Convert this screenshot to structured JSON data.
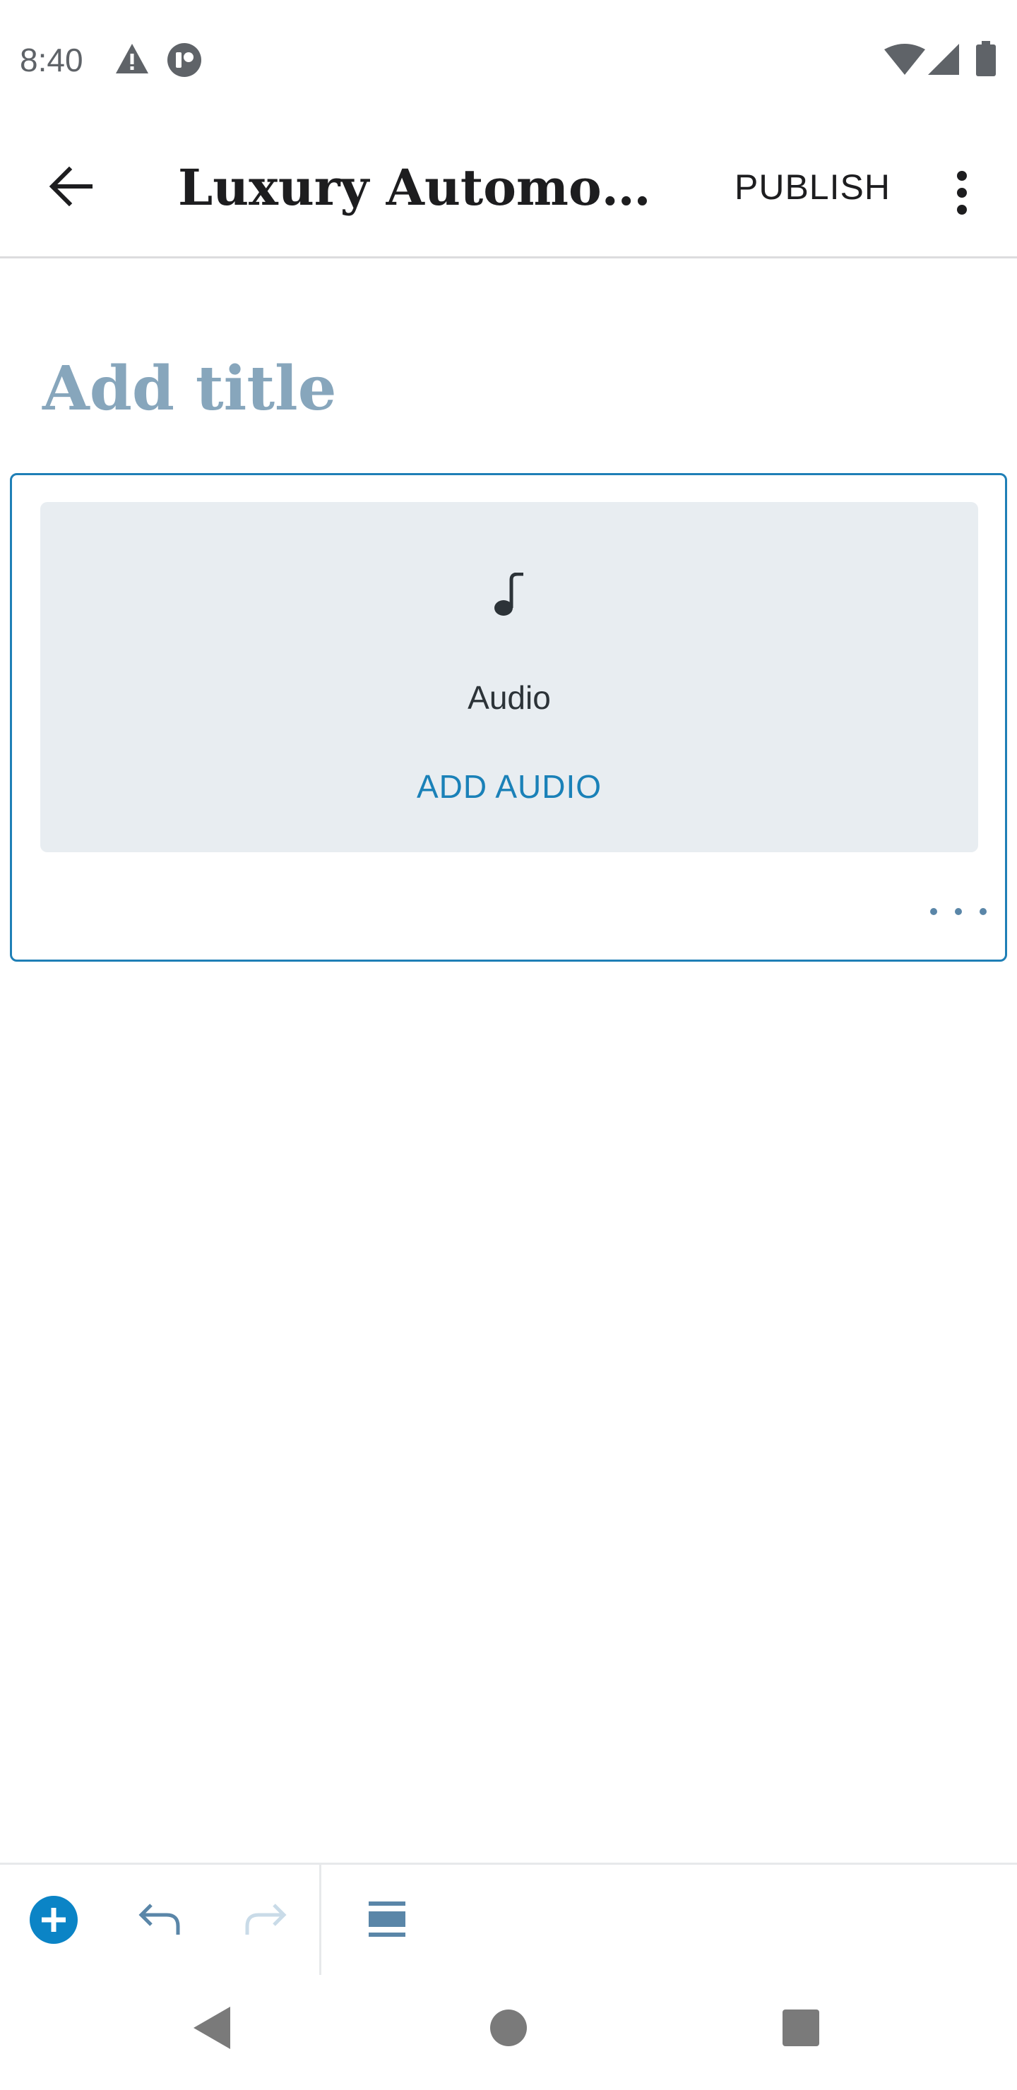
{
  "status_bar": {
    "time": "8:40",
    "icons": [
      "warning-icon",
      "app-notification-icon",
      "wifi-icon",
      "signal-icon",
      "battery-icon"
    ]
  },
  "app_bar": {
    "title": "Luxury Automoti...",
    "publish_label": "PUBLISH",
    "icons": [
      "back-arrow-icon",
      "more-vertical-icon"
    ]
  },
  "editor": {
    "title_placeholder": "Add title",
    "audio_block": {
      "icon": "music-note-icon",
      "label": "Audio",
      "action_label": "ADD AUDIO",
      "more_icon": "more-horizontal-icon"
    }
  },
  "toolbar": {
    "icons": [
      "add-block-icon",
      "undo-icon",
      "redo-icon",
      "block-navigation-icon"
    ]
  },
  "nav_bar": {
    "icons": [
      "nav-back-icon",
      "nav-home-icon",
      "nav-recents-icon"
    ]
  },
  "colors": {
    "accent": "#1a81b8",
    "block_border": "#1f7fb6",
    "title_placeholder": "#87a6bc",
    "placeholder_bg": "#e8edf1"
  }
}
